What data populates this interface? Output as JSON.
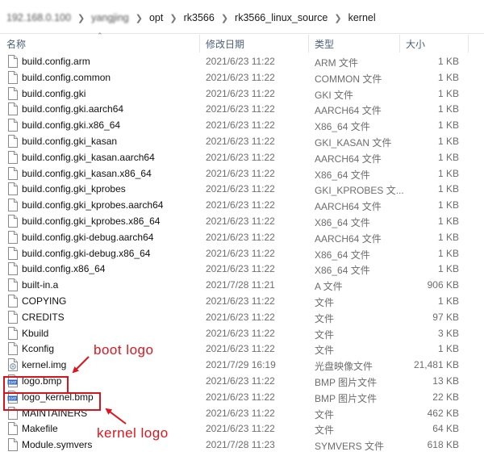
{
  "breadcrumb": [
    "192.168.0.100",
    "yangjing",
    "opt",
    "rk3566",
    "rk3566_linux_source",
    "kernel"
  ],
  "columns": {
    "name": "名称",
    "date": "修改日期",
    "type": "类型",
    "size": "大小"
  },
  "files": [
    {
      "name": "build.config.arm",
      "date": "2021/6/23 11:22",
      "type": "ARM 文件",
      "size": "1 KB",
      "icon": "file-icon"
    },
    {
      "name": "build.config.common",
      "date": "2021/6/23 11:22",
      "type": "COMMON 文件",
      "size": "1 KB",
      "icon": "file-icon"
    },
    {
      "name": "build.config.gki",
      "date": "2021/6/23 11:22",
      "type": "GKI 文件",
      "size": "1 KB",
      "icon": "file-icon"
    },
    {
      "name": "build.config.gki.aarch64",
      "date": "2021/6/23 11:22",
      "type": "AARCH64 文件",
      "size": "1 KB",
      "icon": "file-icon"
    },
    {
      "name": "build.config.gki.x86_64",
      "date": "2021/6/23 11:22",
      "type": "X86_64 文件",
      "size": "1 KB",
      "icon": "file-icon"
    },
    {
      "name": "build.config.gki_kasan",
      "date": "2021/6/23 11:22",
      "type": "GKI_KASAN 文件",
      "size": "1 KB",
      "icon": "file-icon"
    },
    {
      "name": "build.config.gki_kasan.aarch64",
      "date": "2021/6/23 11:22",
      "type": "AARCH64 文件",
      "size": "1 KB",
      "icon": "file-icon"
    },
    {
      "name": "build.config.gki_kasan.x86_64",
      "date": "2021/6/23 11:22",
      "type": "X86_64 文件",
      "size": "1 KB",
      "icon": "file-icon"
    },
    {
      "name": "build.config.gki_kprobes",
      "date": "2021/6/23 11:22",
      "type": "GKI_KPROBES 文...",
      "size": "1 KB",
      "icon": "file-icon"
    },
    {
      "name": "build.config.gki_kprobes.aarch64",
      "date": "2021/6/23 11:22",
      "type": "AARCH64 文件",
      "size": "1 KB",
      "icon": "file-icon"
    },
    {
      "name": "build.config.gki_kprobes.x86_64",
      "date": "2021/6/23 11:22",
      "type": "X86_64 文件",
      "size": "1 KB",
      "icon": "file-icon"
    },
    {
      "name": "build.config.gki-debug.aarch64",
      "date": "2021/6/23 11:22",
      "type": "AARCH64 文件",
      "size": "1 KB",
      "icon": "file-icon"
    },
    {
      "name": "build.config.gki-debug.x86_64",
      "date": "2021/6/23 11:22",
      "type": "X86_64 文件",
      "size": "1 KB",
      "icon": "file-icon"
    },
    {
      "name": "build.config.x86_64",
      "date": "2021/6/23 11:22",
      "type": "X86_64 文件",
      "size": "1 KB",
      "icon": "file-icon"
    },
    {
      "name": "built-in.a",
      "date": "2021/7/28 11:21",
      "type": "A 文件",
      "size": "906 KB",
      "icon": "file-icon"
    },
    {
      "name": "COPYING",
      "date": "2021/6/23 11:22",
      "type": "文件",
      "size": "1 KB",
      "icon": "file-icon"
    },
    {
      "name": "CREDITS",
      "date": "2021/6/23 11:22",
      "type": "文件",
      "size": "97 KB",
      "icon": "file-icon"
    },
    {
      "name": "Kbuild",
      "date": "2021/6/23 11:22",
      "type": "文件",
      "size": "3 KB",
      "icon": "file-icon"
    },
    {
      "name": "Kconfig",
      "date": "2021/6/23 11:22",
      "type": "文件",
      "size": "1 KB",
      "icon": "file-icon"
    },
    {
      "name": "kernel.img",
      "date": "2021/7/29 16:19",
      "type": "光盘映像文件",
      "size": "21,481 KB",
      "icon": "disc-image-icon"
    },
    {
      "name": "logo.bmp",
      "date": "2021/6/23 11:22",
      "type": "BMP 图片文件",
      "size": "13 KB",
      "icon": "bmp-image-icon"
    },
    {
      "name": "logo_kernel.bmp",
      "date": "2021/6/23 11:22",
      "type": "BMP 图片文件",
      "size": "22 KB",
      "icon": "bmp-image-icon"
    },
    {
      "name": "MAINTAINERS",
      "date": "2021/6/23 11:22",
      "type": "文件",
      "size": "462 KB",
      "icon": "file-icon"
    },
    {
      "name": "Makefile",
      "date": "2021/6/23 11:22",
      "type": "文件",
      "size": "64 KB",
      "icon": "file-icon"
    },
    {
      "name": "Module.symvers",
      "date": "2021/7/28 11:23",
      "type": "SYMVERS 文件",
      "size": "618 KB",
      "icon": "file-icon"
    }
  ],
  "annotations": {
    "boot_logo": "boot logo",
    "kernel_logo": "kernel logo"
  },
  "colors": {
    "annotation": "#e0141c",
    "header_text": "#4c607a",
    "secondary_text": "#6d6d6d"
  }
}
